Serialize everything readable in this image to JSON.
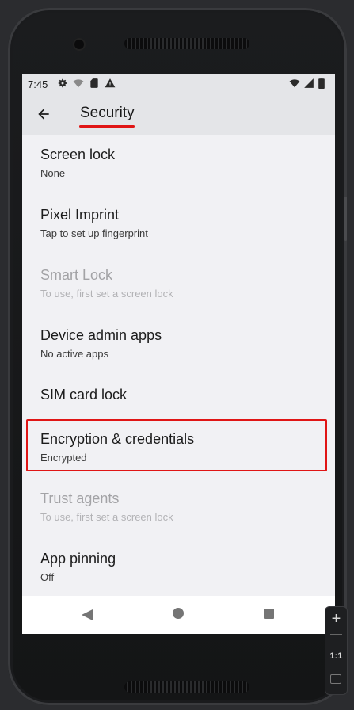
{
  "status_bar": {
    "time": "7:45",
    "left_icons": [
      "gear-icon",
      "wifi-off-icon",
      "sd-card-icon",
      "alert-icon"
    ],
    "right_icons": [
      "wifi-icon",
      "cellular-icon",
      "battery-icon"
    ]
  },
  "app_bar": {
    "title": "Security",
    "back_icon": "arrow-back-icon"
  },
  "items": [
    {
      "primary": "Screen lock",
      "secondary": "None",
      "enabled": true
    },
    {
      "primary": "Pixel Imprint",
      "secondary": "Tap to set up fingerprint",
      "enabled": true
    },
    {
      "primary": "Smart Lock",
      "secondary": "To use, first set a screen lock",
      "enabled": false
    },
    {
      "primary": "Device admin apps",
      "secondary": "No active apps",
      "enabled": true
    },
    {
      "primary": "SIM card lock",
      "secondary": "",
      "enabled": true
    },
    {
      "primary": "Encryption & credentials",
      "secondary": "Encrypted",
      "enabled": true,
      "highlighted": true
    },
    {
      "primary": "Trust agents",
      "secondary": "To use, first set a screen lock",
      "enabled": false
    },
    {
      "primary": "App pinning",
      "secondary": "Off",
      "enabled": true
    }
  ],
  "nav_bar": {
    "icons": [
      "nav-back-icon",
      "nav-home-icon",
      "nav-recents-icon"
    ]
  },
  "emulator_controls": {
    "zoom_in": "+",
    "reset": "1:1"
  },
  "colors": {
    "highlight": "#e01515",
    "app_bar_bg": "#e4e5e8",
    "screen_bg": "#f1f1f4"
  }
}
